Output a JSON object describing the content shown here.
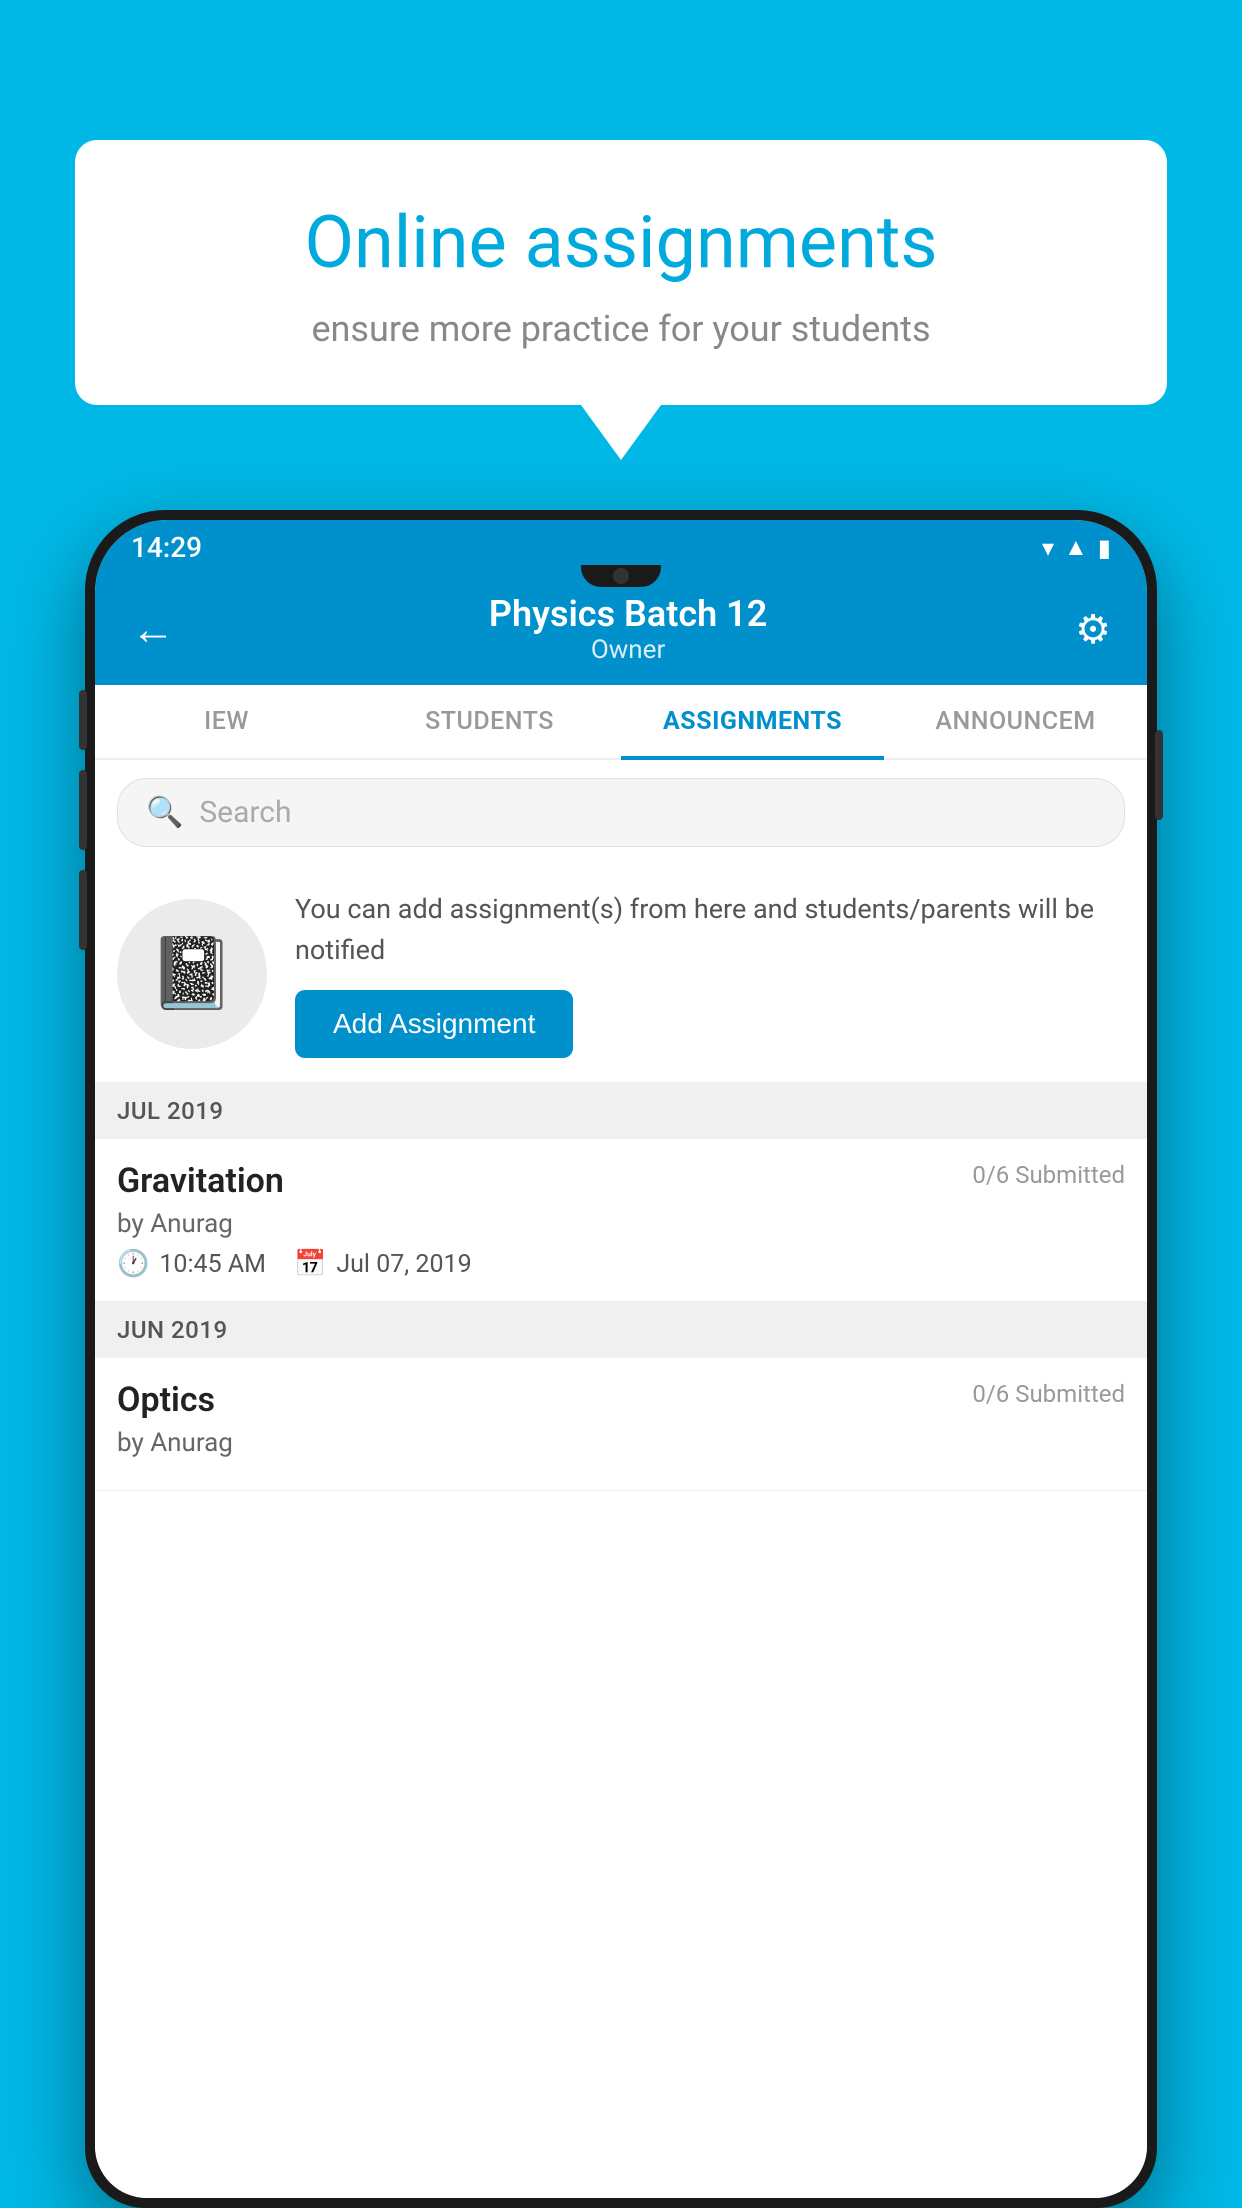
{
  "background_color": "#00b8e6",
  "speech_bubble": {
    "title": "Online assignments",
    "subtitle": "ensure more practice for your students"
  },
  "phone": {
    "status_bar": {
      "time": "14:29",
      "icons": [
        "wifi",
        "signal",
        "battery"
      ]
    },
    "header": {
      "title": "Physics Batch 12",
      "subtitle": "Owner",
      "back_label": "←",
      "settings_label": "⚙"
    },
    "tabs": [
      {
        "label": "IEW",
        "active": false
      },
      {
        "label": "STUDENTS",
        "active": false
      },
      {
        "label": "ASSIGNMENTS",
        "active": true
      },
      {
        "label": "ANNOUNCEM",
        "active": false
      }
    ],
    "search": {
      "placeholder": "Search"
    },
    "promo": {
      "description": "You can add assignment(s) from here and students/parents will be notified",
      "button_label": "Add Assignment"
    },
    "sections": [
      {
        "month": "JUL 2019",
        "assignments": [
          {
            "name": "Gravitation",
            "submitted": "0/6 Submitted",
            "by": "by Anurag",
            "time": "10:45 AM",
            "date": "Jul 07, 2019"
          }
        ]
      },
      {
        "month": "JUN 2019",
        "assignments": [
          {
            "name": "Optics",
            "submitted": "0/6 Submitted",
            "by": "by Anurag",
            "time": "",
            "date": ""
          }
        ]
      }
    ]
  }
}
